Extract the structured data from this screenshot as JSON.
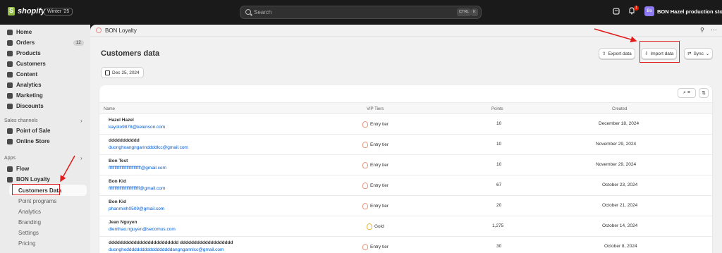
{
  "topbar": {
    "brand": "shopify",
    "edition": "Winter '25",
    "search_placeholder": "Search",
    "kbd_ctrl": "CTRL",
    "kbd_k": "K",
    "notification_count": "1",
    "store_initials": "Bo",
    "store_name": "BON Hazel production sto..."
  },
  "sidebar": {
    "items": [
      {
        "label": "Home",
        "icon": "home-icon"
      },
      {
        "label": "Orders",
        "icon": "orders-icon",
        "badge": "12"
      },
      {
        "label": "Products",
        "icon": "tag-icon"
      },
      {
        "label": "Customers",
        "icon": "person-icon"
      },
      {
        "label": "Content",
        "icon": "content-icon"
      },
      {
        "label": "Analytics",
        "icon": "chart-icon"
      },
      {
        "label": "Marketing",
        "icon": "target-icon"
      },
      {
        "label": "Discounts",
        "icon": "discount-icon"
      }
    ],
    "sales_channels_title": "Sales channels",
    "sales_channels": [
      {
        "label": "Point of Sale",
        "icon": "pos-icon"
      },
      {
        "label": "Online Store",
        "icon": "store-icon"
      }
    ],
    "apps_title": "Apps",
    "apps": [
      {
        "label": "Flow",
        "icon": "flow-icon"
      },
      {
        "label": "BON Loyalty",
        "icon": "loyalty-icon"
      }
    ],
    "app_subitems": [
      "Customers Data",
      "Point programs",
      "Analytics",
      "Branding",
      "Settings",
      "Pricing"
    ]
  },
  "main": {
    "app_title": "BON Loyalty",
    "page_title": "Customers data",
    "export_label": "Export data",
    "import_label": "Import data",
    "sync_label": "Sync",
    "date_label": "Dec 25, 2024",
    "columns": [
      "Name",
      "VIP Tiers",
      "Points",
      "Created"
    ],
    "rows": [
      {
        "name": "Hazel Hazel",
        "email": "kayoto9878@kelenson.com",
        "tier": "Entry tier",
        "points": "10",
        "created": "December 18, 2024"
      },
      {
        "name": "ddddddddddd",
        "email": "duonghoangngannddddlcc@gmail.com",
        "tier": "Entry tier",
        "points": "10",
        "created": "November 29, 2024"
      },
      {
        "name": "Bon Test",
        "email": "fffffffffffffffffffffffffff@gmail.com",
        "tier": "Entry tier",
        "points": "10",
        "created": "November 29, 2024"
      },
      {
        "name": "Bon Kid",
        "email": "ffffffffffffffffffffffffff@gmail.com",
        "tier": "Entry tier",
        "points": "67",
        "created": "October 23, 2024"
      },
      {
        "name": "Bon Kid",
        "email": "phanminh0509@gmail.com",
        "tier": "Entry tier",
        "points": "20",
        "created": "October 21, 2024"
      },
      {
        "name": "Jean Nguyen",
        "email": "dienthao.nguyen@secomus.com",
        "tier": "Gold",
        "points": "1,275",
        "created": "October 14, 2024"
      },
      {
        "name": "ddddddddddddddddddddddddd ddddddddddddddddddd",
        "email": "duonghoddddddddddddddddddangngannlcc@gmail.com",
        "tier": "Entry tier",
        "points": "30",
        "created": "October 8, 2024"
      }
    ]
  },
  "colors": {
    "sidebar_bg": "#ebebeb",
    "topbar_bg": "#1a1a1a",
    "link": "#005bd3",
    "annotation": "#e01b1b"
  }
}
